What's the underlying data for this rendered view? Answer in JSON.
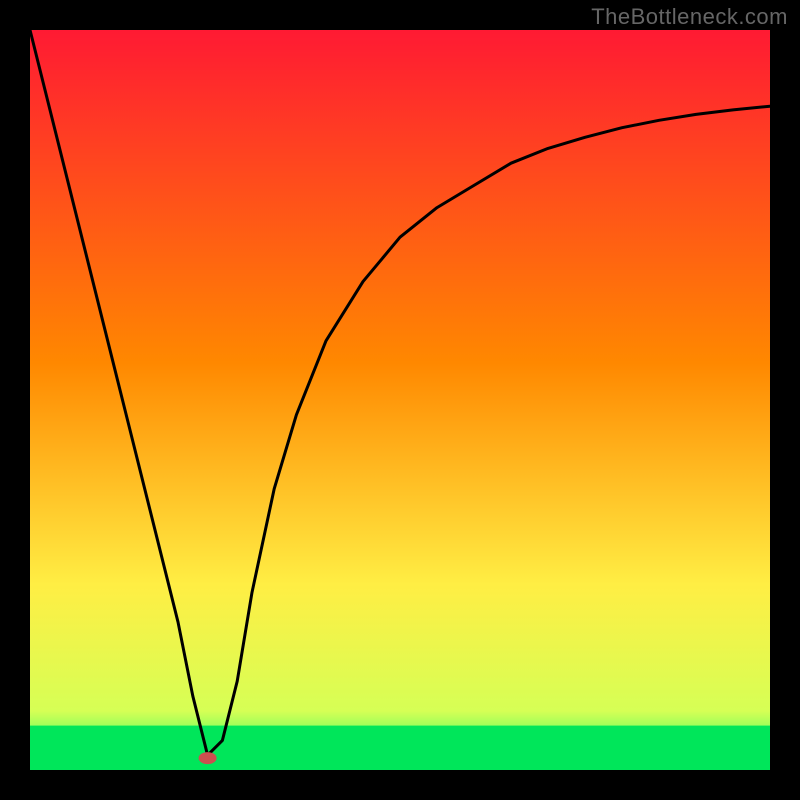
{
  "watermark": "TheBottleneck.com",
  "chart_data": {
    "type": "line",
    "title": "",
    "xlabel": "",
    "ylabel": "",
    "xlim": [
      0,
      100
    ],
    "ylim": [
      0,
      100
    ],
    "background_gradient": [
      "#00ff66",
      "#ffee44",
      "#ff8800",
      "#ff1a33"
    ],
    "green_band": {
      "y0": 0,
      "y1": 6
    },
    "series": [
      {
        "name": "curve",
        "x": [
          0,
          5,
          10,
          15,
          20,
          22,
          24,
          26,
          28,
          30,
          33,
          36,
          40,
          45,
          50,
          55,
          60,
          65,
          70,
          75,
          80,
          85,
          90,
          95,
          100
        ],
        "values": [
          100,
          80,
          60,
          40,
          20,
          10,
          2,
          4,
          12,
          24,
          38,
          48,
          58,
          66,
          72,
          76,
          79,
          82,
          84,
          85.5,
          86.8,
          87.8,
          88.6,
          89.2,
          89.7
        ]
      }
    ],
    "marker": {
      "x": 24,
      "y": 1.6,
      "color": "#cc4f4f",
      "rx": 9,
      "ry": 6
    }
  }
}
